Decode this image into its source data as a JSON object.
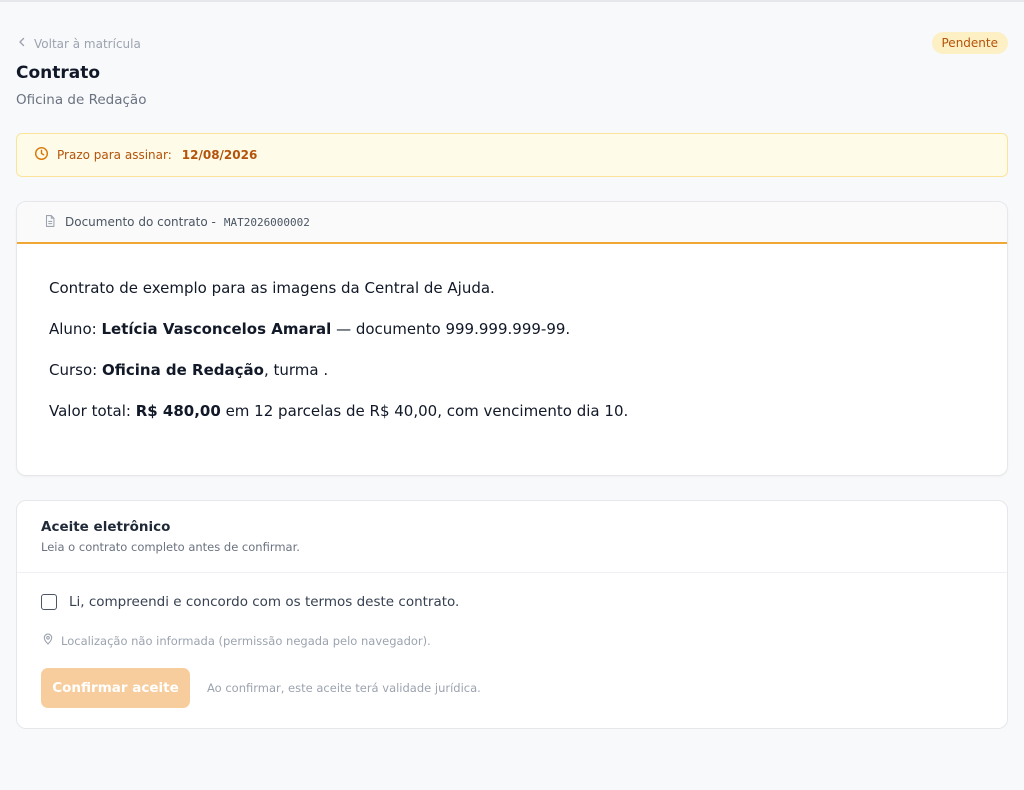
{
  "nav": {
    "back_label": "Voltar à matrícula"
  },
  "status": {
    "label": "Pendente"
  },
  "page": {
    "title": "Contrato",
    "subtitle": "Oficina de Redação"
  },
  "deadline": {
    "label": "Prazo para assinar:",
    "date": "12/08/2026"
  },
  "contract": {
    "header_label": "Documento do contrato -",
    "code": "MAT2026000002",
    "intro": "Contrato de exemplo para as imagens da Central de Ajuda.",
    "student_prefix": "Aluno:",
    "student_name": "Letícia Vasconcelos Amaral",
    "student_suffix": "— documento 999.999.999-99.",
    "course_prefix": "Curso:",
    "course_name": "Oficina de Redação",
    "course_suffix": ", turma .",
    "value_prefix": "Valor total:",
    "value_amount": "R$ 480,00",
    "value_suffix": "em 12 parcelas de R$ 40,00, com vencimento dia 10."
  },
  "acceptance": {
    "title": "Aceite eletrônico",
    "description": "Leia o contrato completo antes de confirmar.",
    "agree_label": "Li, compreendi e concordo com os termos deste contrato.",
    "agree_checked": false,
    "location_text": "Localização não informada (permissão negada pelo navegador).",
    "confirm_label": "Confirmar aceite",
    "confirm_note": "Ao confirmar, este aceite terá validade jurídica."
  },
  "colors": {
    "accent": "#f0a733",
    "badge_bg": "#fdf0c4",
    "badge_text": "#b45309",
    "banner_bg": "#fefbe8",
    "button_disabled": "#f7cd9d"
  },
  "icons": {
    "back": "chevron-left-icon",
    "deadline": "clock-icon",
    "document": "document-icon",
    "location": "map-pin-icon"
  }
}
